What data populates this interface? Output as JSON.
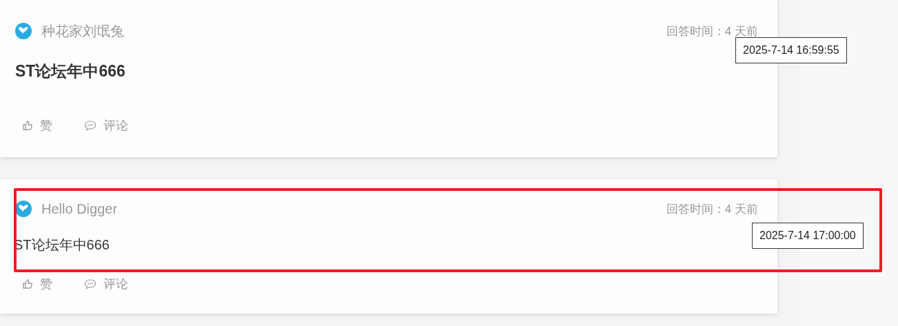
{
  "answers": [
    {
      "author": "种花家刘氓兔",
      "time_label": "回答时间：4 天前",
      "content": "ST论坛年中666",
      "emphasized": true,
      "actions": [
        {
          "kind": "like",
          "label": "赞"
        },
        {
          "kind": "comment",
          "label": "评论"
        }
      ],
      "tooltip": "2025-7-14 16:59:55",
      "highlighted": false
    },
    {
      "author": "Hello Digger",
      "time_label": "回答时间：4 天前",
      "content": "ST论坛年中666",
      "emphasized": false,
      "actions": [
        {
          "kind": "like",
          "label": "赞"
        },
        {
          "kind": "comment",
          "label": "评论"
        }
      ],
      "tooltip": "2025-7-14 17:00:00",
      "highlighted": true
    }
  ]
}
